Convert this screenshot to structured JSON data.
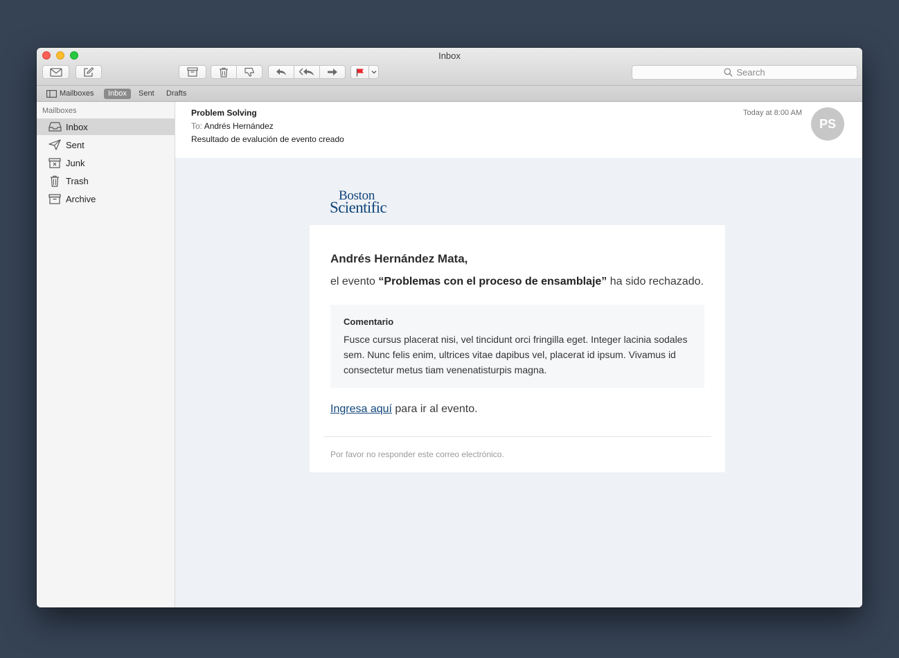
{
  "window": {
    "title": "Inbox"
  },
  "toolbar": {
    "search_placeholder": "Search"
  },
  "favorites": {
    "mailboxes_label": "Mailboxes",
    "inbox_label": "Inbox",
    "sent_label": "Sent",
    "drafts_label": "Drafts"
  },
  "sidebar": {
    "header": "Mailboxes",
    "items": [
      {
        "label": "Inbox",
        "icon": "inbox-icon"
      },
      {
        "label": "Sent",
        "icon": "paper-plane-icon"
      },
      {
        "label": "Junk",
        "icon": "junk-icon"
      },
      {
        "label": "Trash",
        "icon": "trash-icon"
      },
      {
        "label": "Archive",
        "icon": "archive-icon"
      }
    ]
  },
  "message": {
    "from": "Problem Solving",
    "to_label": "To:",
    "to": "Andrés Hernández",
    "subject": "Resultado de evalución de evento creado",
    "date": "Today at 8:00 AM",
    "avatar_initials": "PS"
  },
  "email": {
    "logo_line1": "Boston",
    "logo_line2": "Scientific",
    "greeting": "Andrés Hernández Mata,",
    "line_prefix": "el evento ",
    "event_name": "“Problemas con el proceso de ensamblaje”",
    "line_suffix": " ha sido rechazado.",
    "comment_title": "Comentario",
    "comment_text": "Fusce cursus placerat nisi, vel tincidunt orci fringilla eget. Integer lacinia sodales sem. Nunc felis enim, ultrices vitae dapibus vel, placerat id ipsum. Vivamus id consectetur metus tiam venenatisturpis magna.",
    "link_text": "Ingresa aquí",
    "link_suffix": " para ir al evento.",
    "footer": "Por favor no responder este correo electrónico."
  },
  "colors": {
    "brand": "#10457a",
    "desktop": "#364355",
    "flag": "#e8262b"
  }
}
